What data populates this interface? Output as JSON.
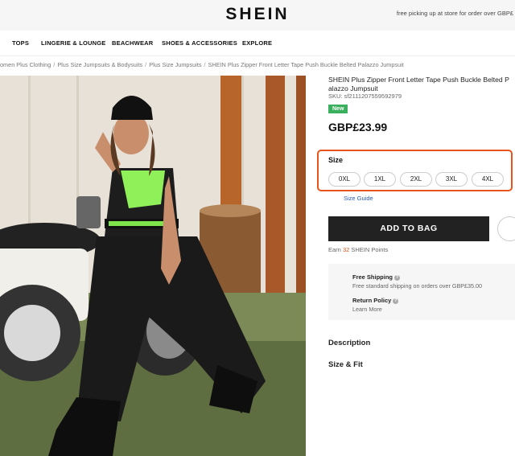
{
  "header": {
    "logo": "SHEIN",
    "promo": "free picking up at store for order over GBP£"
  },
  "nav": [
    {
      "label": "TOPS"
    },
    {
      "label": "LINGERIE & LOUNGE"
    },
    {
      "label": "BEACHWEAR"
    },
    {
      "label": "SHOES & ACCESSORIES"
    },
    {
      "label": "EXPLORE"
    }
  ],
  "breadcrumb": [
    "omen Plus Clothing",
    "Plus Size Jumpsuits & Bodysuits",
    "Plus Size Jumpsuits",
    "SHEIN Plus Zipper Front Letter Tape Push Buckle Belted Palazzo Jumpsuit"
  ],
  "product": {
    "title": "SHEIN Plus Zipper Front Letter Tape Push Buckle Belted P alazzo Jumpsuit",
    "sku": "SKU: sf2111207559592979",
    "badge": "New",
    "price": "GBP£23.99",
    "size_label": "Size",
    "sizes": [
      "0XL",
      "1XL",
      "2XL",
      "3XL",
      "4XL"
    ],
    "size_guide": "Size Guide",
    "add_to_bag": "ADD TO BAG",
    "points": {
      "prefix": "Earn",
      "value": "32",
      "suffix": "SHEIN Points"
    }
  },
  "shipping": {
    "free_title": "Free Shipping",
    "free_sub": "Free standard shipping on orders over GBP£35.00",
    "return_title": "Return Policy",
    "return_sub": "Learn More"
  },
  "sections": {
    "description": "Description",
    "size_fit": "Size & Fit"
  },
  "colors": {
    "accent_highlight": "#e8541c",
    "badge_new": "#3aaf5d",
    "button_dark": "#222222",
    "link": "#2a5ab3"
  }
}
